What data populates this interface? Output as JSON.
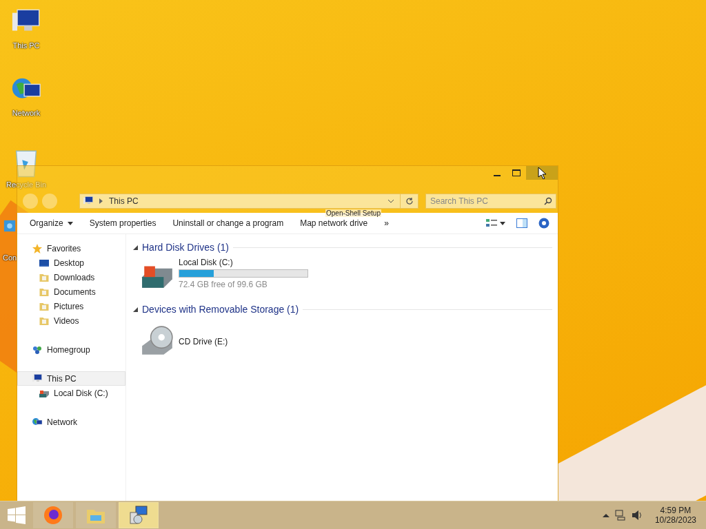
{
  "desktop_icons": [
    {
      "label": "This PC",
      "kind": "pc"
    },
    {
      "label": "Network",
      "kind": "network"
    },
    {
      "label": "Recycle Bin",
      "kind": "bin"
    },
    {
      "label": "Con",
      "kind": "panel"
    }
  ],
  "window": {
    "ghost_title": "Open-Shell Setup",
    "address": "This PC",
    "search": {
      "placeholder": "Search This PC"
    }
  },
  "toolbar": [
    {
      "label": "Organize",
      "kind": "menu"
    },
    {
      "label": "System properties",
      "kind": "command"
    },
    {
      "label": "Uninstall or change a program",
      "kind": "command"
    },
    {
      "label": "Map network drive",
      "kind": "command"
    },
    {
      "label": "»",
      "kind": "more"
    }
  ],
  "nav": [
    {
      "label": "Favorites",
      "kind": "star",
      "selected": false,
      "children": [
        {
          "label": "Desktop",
          "kind": "desktop",
          "selected": false
        },
        {
          "label": "Downloads",
          "kind": "folder",
          "selected": false
        },
        {
          "label": "Documents",
          "kind": "folder",
          "selected": false
        },
        {
          "label": "Pictures",
          "kind": "folder",
          "selected": false
        },
        {
          "label": "Videos",
          "kind": "folder",
          "selected": false
        }
      ]
    },
    {
      "label": "Homegroup",
      "kind": "homegroup",
      "selected": false
    },
    {
      "label": "This PC",
      "kind": "pc",
      "selected": true,
      "children": [
        {
          "label": "Local Disk (C:)",
          "kind": "disk",
          "selected": false
        }
      ]
    },
    {
      "label": "Network",
      "kind": "network",
      "selected": false
    }
  ],
  "sections": [
    {
      "title": "Hard Disk Drives (1)",
      "expanded": true,
      "items": [
        {
          "name": "Local Disk (C:)",
          "kind": "disk",
          "level": 0.27,
          "detail": "72.4 GB free of 99.6 GB"
        }
      ]
    },
    {
      "title": "Devices with Removable Storage (1)",
      "expanded": true,
      "items": [
        {
          "name": "CD Drive (E:)",
          "kind": "cd"
        }
      ]
    }
  ],
  "taskbar": {
    "apps": [
      {
        "kind": "firefox",
        "selected": false
      },
      {
        "kind": "explorer",
        "selected": false
      },
      {
        "kind": "setup",
        "selected": true
      }
    ],
    "time": "4:59 PM",
    "date": "10/28/2023"
  }
}
